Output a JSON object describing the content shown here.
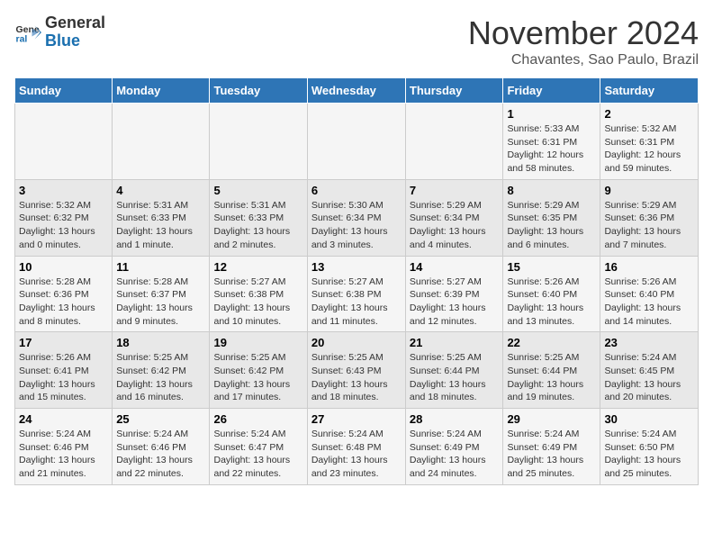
{
  "header": {
    "logo_general": "General",
    "logo_blue": "Blue",
    "month_title": "November 2024",
    "location": "Chavantes, Sao Paulo, Brazil"
  },
  "days_of_week": [
    "Sunday",
    "Monday",
    "Tuesday",
    "Wednesday",
    "Thursday",
    "Friday",
    "Saturday"
  ],
  "weeks": [
    [
      {
        "day": "",
        "info": ""
      },
      {
        "day": "",
        "info": ""
      },
      {
        "day": "",
        "info": ""
      },
      {
        "day": "",
        "info": ""
      },
      {
        "day": "",
        "info": ""
      },
      {
        "day": "1",
        "info": "Sunrise: 5:33 AM\nSunset: 6:31 PM\nDaylight: 12 hours and 58 minutes."
      },
      {
        "day": "2",
        "info": "Sunrise: 5:32 AM\nSunset: 6:31 PM\nDaylight: 12 hours and 59 minutes."
      }
    ],
    [
      {
        "day": "3",
        "info": "Sunrise: 5:32 AM\nSunset: 6:32 PM\nDaylight: 13 hours and 0 minutes."
      },
      {
        "day": "4",
        "info": "Sunrise: 5:31 AM\nSunset: 6:33 PM\nDaylight: 13 hours and 1 minute."
      },
      {
        "day": "5",
        "info": "Sunrise: 5:31 AM\nSunset: 6:33 PM\nDaylight: 13 hours and 2 minutes."
      },
      {
        "day": "6",
        "info": "Sunrise: 5:30 AM\nSunset: 6:34 PM\nDaylight: 13 hours and 3 minutes."
      },
      {
        "day": "7",
        "info": "Sunrise: 5:29 AM\nSunset: 6:34 PM\nDaylight: 13 hours and 4 minutes."
      },
      {
        "day": "8",
        "info": "Sunrise: 5:29 AM\nSunset: 6:35 PM\nDaylight: 13 hours and 6 minutes."
      },
      {
        "day": "9",
        "info": "Sunrise: 5:29 AM\nSunset: 6:36 PM\nDaylight: 13 hours and 7 minutes."
      }
    ],
    [
      {
        "day": "10",
        "info": "Sunrise: 5:28 AM\nSunset: 6:36 PM\nDaylight: 13 hours and 8 minutes."
      },
      {
        "day": "11",
        "info": "Sunrise: 5:28 AM\nSunset: 6:37 PM\nDaylight: 13 hours and 9 minutes."
      },
      {
        "day": "12",
        "info": "Sunrise: 5:27 AM\nSunset: 6:38 PM\nDaylight: 13 hours and 10 minutes."
      },
      {
        "day": "13",
        "info": "Sunrise: 5:27 AM\nSunset: 6:38 PM\nDaylight: 13 hours and 11 minutes."
      },
      {
        "day": "14",
        "info": "Sunrise: 5:27 AM\nSunset: 6:39 PM\nDaylight: 13 hours and 12 minutes."
      },
      {
        "day": "15",
        "info": "Sunrise: 5:26 AM\nSunset: 6:40 PM\nDaylight: 13 hours and 13 minutes."
      },
      {
        "day": "16",
        "info": "Sunrise: 5:26 AM\nSunset: 6:40 PM\nDaylight: 13 hours and 14 minutes."
      }
    ],
    [
      {
        "day": "17",
        "info": "Sunrise: 5:26 AM\nSunset: 6:41 PM\nDaylight: 13 hours and 15 minutes."
      },
      {
        "day": "18",
        "info": "Sunrise: 5:25 AM\nSunset: 6:42 PM\nDaylight: 13 hours and 16 minutes."
      },
      {
        "day": "19",
        "info": "Sunrise: 5:25 AM\nSunset: 6:42 PM\nDaylight: 13 hours and 17 minutes."
      },
      {
        "day": "20",
        "info": "Sunrise: 5:25 AM\nSunset: 6:43 PM\nDaylight: 13 hours and 18 minutes."
      },
      {
        "day": "21",
        "info": "Sunrise: 5:25 AM\nSunset: 6:44 PM\nDaylight: 13 hours and 18 minutes."
      },
      {
        "day": "22",
        "info": "Sunrise: 5:25 AM\nSunset: 6:44 PM\nDaylight: 13 hours and 19 minutes."
      },
      {
        "day": "23",
        "info": "Sunrise: 5:24 AM\nSunset: 6:45 PM\nDaylight: 13 hours and 20 minutes."
      }
    ],
    [
      {
        "day": "24",
        "info": "Sunrise: 5:24 AM\nSunset: 6:46 PM\nDaylight: 13 hours and 21 minutes."
      },
      {
        "day": "25",
        "info": "Sunrise: 5:24 AM\nSunset: 6:46 PM\nDaylight: 13 hours and 22 minutes."
      },
      {
        "day": "26",
        "info": "Sunrise: 5:24 AM\nSunset: 6:47 PM\nDaylight: 13 hours and 22 minutes."
      },
      {
        "day": "27",
        "info": "Sunrise: 5:24 AM\nSunset: 6:48 PM\nDaylight: 13 hours and 23 minutes."
      },
      {
        "day": "28",
        "info": "Sunrise: 5:24 AM\nSunset: 6:49 PM\nDaylight: 13 hours and 24 minutes."
      },
      {
        "day": "29",
        "info": "Sunrise: 5:24 AM\nSunset: 6:49 PM\nDaylight: 13 hours and 25 minutes."
      },
      {
        "day": "30",
        "info": "Sunrise: 5:24 AM\nSunset: 6:50 PM\nDaylight: 13 hours and 25 minutes."
      }
    ]
  ]
}
